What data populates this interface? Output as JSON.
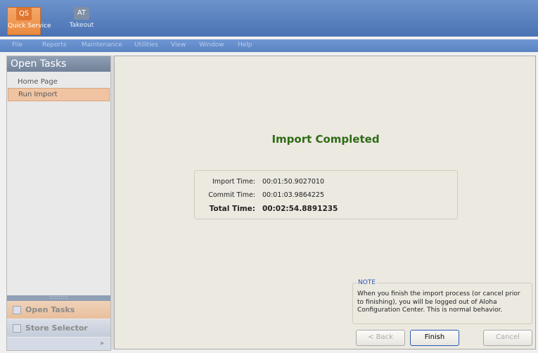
{
  "apps": [
    {
      "abbr": "QS",
      "label": "Quick Service"
    },
    {
      "abbr": "AT",
      "label": "Takeout"
    }
  ],
  "menu": [
    "File",
    "Reports",
    "Maintenance",
    "Utilities",
    "View",
    "Window",
    "Help"
  ],
  "sidebar": {
    "title": "Open Tasks",
    "items": [
      {
        "label": "Home Page"
      },
      {
        "label": "Run Import"
      }
    ],
    "grip": "::::::::::",
    "tabs": [
      {
        "label": "Open Tasks"
      },
      {
        "label": "Store Selector"
      }
    ],
    "chevron": "»"
  },
  "main": {
    "title": "Import Completed",
    "times": [
      {
        "label": "Import Time:",
        "value": "00:01:50.9027010"
      },
      {
        "label": "Commit Time:",
        "value": "00:01:03.9864225"
      },
      {
        "label": "Total Time:",
        "value": "00:02:54.8891235"
      }
    ],
    "note": {
      "label": "NOTE",
      "text": "When you finish the import process (or cancel prior to finishing), you will be logged out of Aloha Configuration Center. This is normal behavior."
    },
    "buttons": {
      "back": "< Back",
      "finish": "Finish",
      "cancel": "Cancel"
    }
  }
}
